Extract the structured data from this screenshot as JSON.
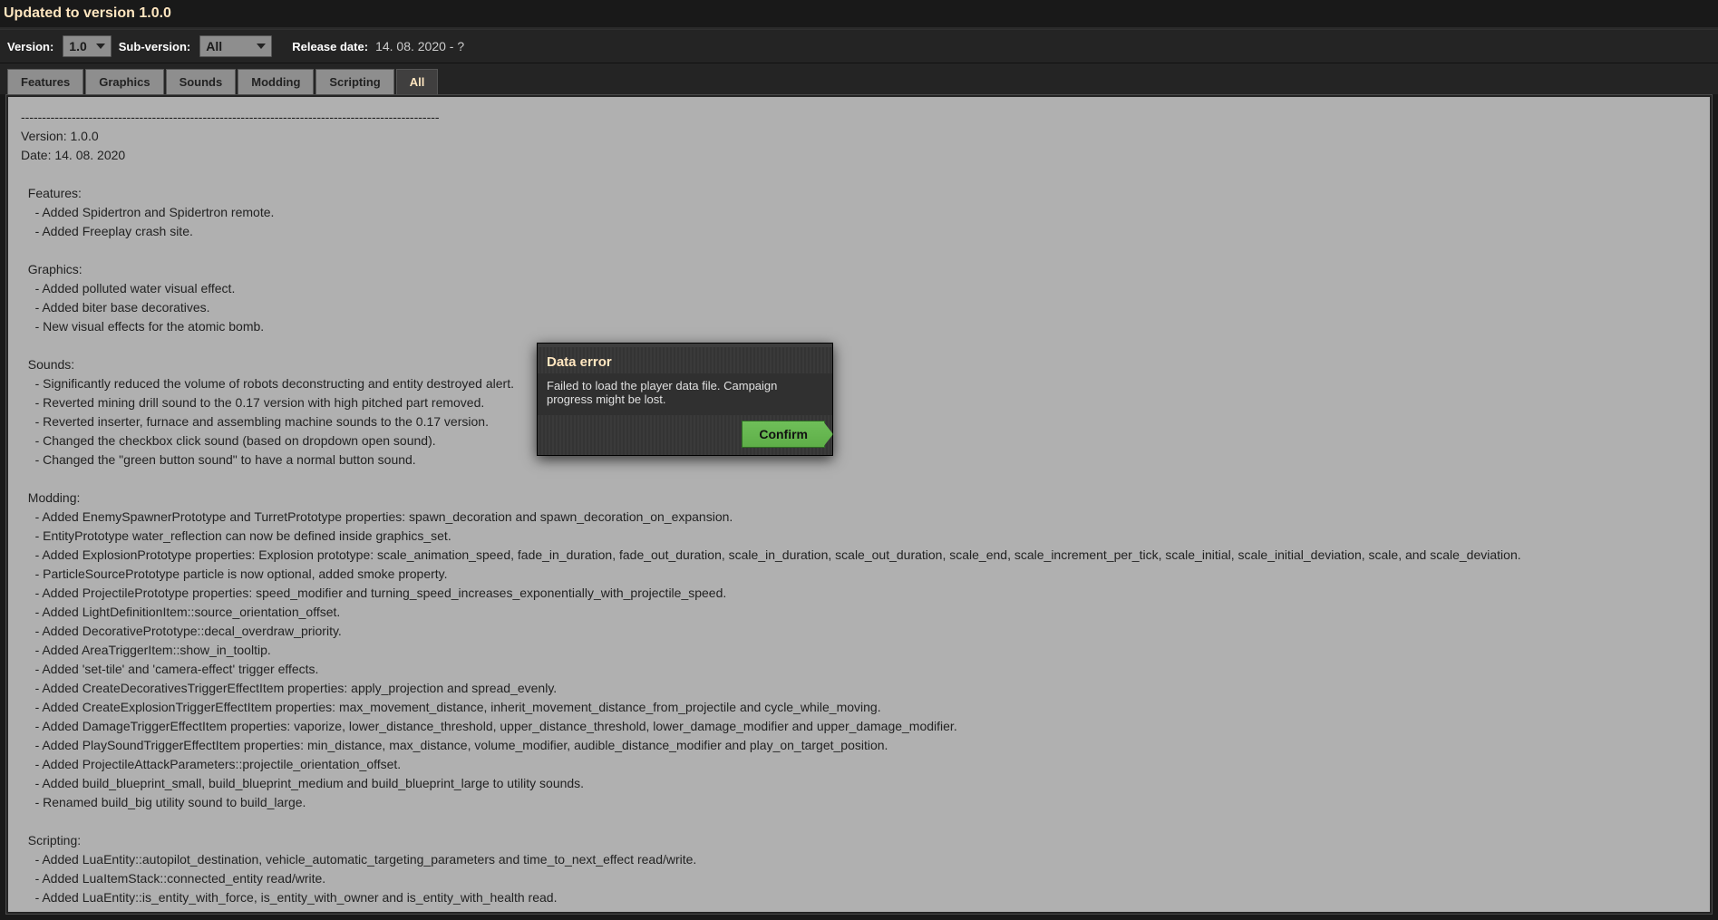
{
  "header": {
    "title": "Updated to version 1.0.0"
  },
  "filters": {
    "version_label": "Version:",
    "version_value": "1.0",
    "subversion_label": "Sub-version:",
    "subversion_value": "All",
    "release_label": "Release date:",
    "release_value": "14. 08. 2020 - ?"
  },
  "tabs": {
    "features": "Features",
    "graphics": "Graphics",
    "sounds": "Sounds",
    "modding": "Modding",
    "scripting": "Scripting",
    "all": "All"
  },
  "changelog": "---------------------------------------------------------------------------------------------------\nVersion: 1.0.0\nDate: 14. 08. 2020\n\n  Features:\n    - Added Spidertron and Spidertron remote.\n    - Added Freeplay crash site.\n\n  Graphics:\n    - Added polluted water visual effect.\n    - Added biter base decoratives.\n    - New visual effects for the atomic bomb.\n\n  Sounds:\n    - Significantly reduced the volume of robots deconstructing and entity destroyed alert.\n    - Reverted mining drill sound to the 0.17 version with high pitched part removed.\n    - Reverted inserter, furnace and assembling machine sounds to the 0.17 version.\n    - Changed the checkbox click sound (based on dropdown open sound).\n    - Changed the \"green button sound\" to have a normal button sound.\n\n  Modding:\n    - Added EnemySpawnerPrototype and TurretPrototype properties: spawn_decoration and spawn_decoration_on_expansion.\n    - EntityPrototype water_reflection can now be defined inside graphics_set.\n    - Added ExplosionPrototype properties: Explosion prototype: scale_animation_speed, fade_in_duration, fade_out_duration, scale_in_duration, scale_out_duration, scale_end, scale_increment_per_tick, scale_initial, scale_initial_deviation, scale, and scale_deviation.\n    - ParticleSourcePrototype particle is now optional, added smoke property.\n    - Added ProjectilePrototype properties: speed_modifier and turning_speed_increases_exponentially_with_projectile_speed.\n    - Added LightDefinitionItem::source_orientation_offset.\n    - Added DecorativePrototype::decal_overdraw_priority.\n    - Added AreaTriggerItem::show_in_tooltip.\n    - Added 'set-tile' and 'camera-effect' trigger effects.\n    - Added CreateDecorativesTriggerEffectItem properties: apply_projection and spread_evenly.\n    - Added CreateExplosionTriggerEffectItem properties: max_movement_distance, inherit_movement_distance_from_projectile and cycle_while_moving.\n    - Added DamageTriggerEffectItem properties: vaporize, lower_distance_threshold, upper_distance_threshold, lower_damage_modifier and upper_damage_modifier.\n    - Added PlaySoundTriggerEffectItem properties: min_distance, max_distance, volume_modifier, audible_distance_modifier and play_on_target_position.\n    - Added ProjectileAttackParameters::projectile_orientation_offset.\n    - Added build_blueprint_small, build_blueprint_medium and build_blueprint_large to utility sounds.\n    - Renamed build_big utility sound to build_large.\n\n  Scripting:\n    - Added LuaEntity::autopilot_destination, vehicle_automatic_targeting_parameters and time_to_next_effect read/write.\n    - Added LuaItemStack::connected_entity read/write.\n    - Added LuaEntity::is_entity_with_force, is_entity_with_owner and is_entity_with_health read.\n    - Added LuaEntity::spawn_decorations().",
  "dialog": {
    "title": "Data error",
    "body": "Failed to load the player data file. Campaign progress might be lost.",
    "confirm": "Confirm"
  }
}
